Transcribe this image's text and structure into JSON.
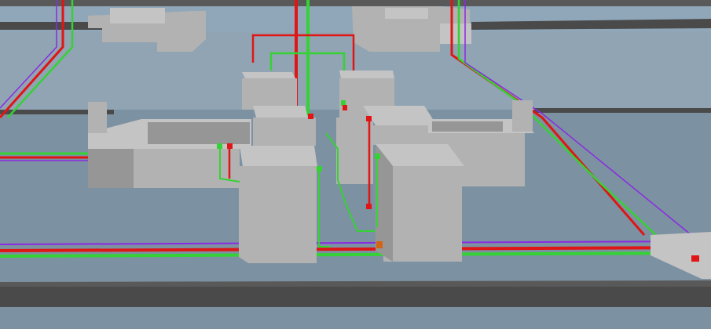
{
  "scene": {
    "kind": "3d-plumbing-model-render",
    "colors": {
      "sky": "#8fa7b9",
      "floor": "#7c91a1",
      "floor_far": "#90a4b3",
      "slab_top": "#595959",
      "slab_front": "#4a4a4a",
      "wall_light": "#c4c4c4",
      "wall_mid": "#b2b2b2",
      "wall_dark": "#969696",
      "hot_pipe": "#e01515",
      "cold_pipe": "#35d235",
      "purple_pipe": "#8a2be2",
      "orange_marker": "#d26414"
    }
  }
}
